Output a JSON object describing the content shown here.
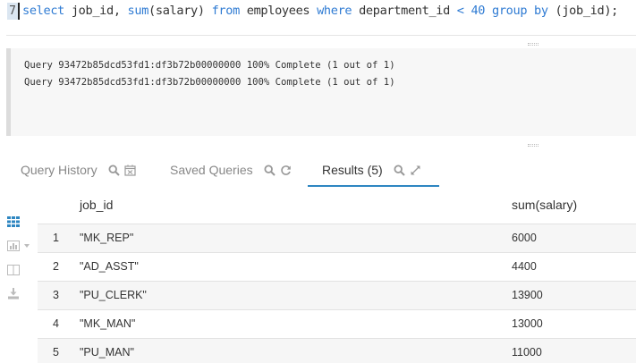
{
  "editor": {
    "line_number": "7",
    "tokens": [
      {
        "t": "select",
        "kw": true
      },
      {
        "t": " job_id, ",
        "kw": false
      },
      {
        "t": "sum",
        "kw": true
      },
      {
        "t": "(salary) ",
        "kw": false
      },
      {
        "t": "from",
        "kw": true
      },
      {
        "t": " employees ",
        "kw": false
      },
      {
        "t": "where",
        "kw": true
      },
      {
        "t": " department_id ",
        "kw": false
      },
      {
        "t": "<",
        "kw": true
      },
      {
        "t": " ",
        "kw": false
      },
      {
        "t": "40",
        "kw": true
      },
      {
        "t": " ",
        "kw": false
      },
      {
        "t": "group",
        "kw": true
      },
      {
        "t": " ",
        "kw": false
      },
      {
        "t": "by",
        "kw": true
      },
      {
        "t": " (job_id);",
        "kw": false
      }
    ]
  },
  "log": {
    "lines": [
      "Query 93472b85dcd53fd1:df3b72b00000000 100% Complete (1 out of 1)",
      "Query 93472b85dcd53fd1:df3b72b00000000 100% Complete (1 out of 1)"
    ]
  },
  "tabs": {
    "query_history": "Query History",
    "saved_queries": "Saved Queries",
    "results": "Results (5)"
  },
  "table": {
    "headers": [
      "job_id",
      "sum(salary)"
    ],
    "rows": [
      {
        "idx": "1",
        "job_id": "\"MK_REP\"",
        "salary": "6000"
      },
      {
        "idx": "2",
        "job_id": "\"AD_ASST\"",
        "salary": "4400"
      },
      {
        "idx": "3",
        "job_id": "\"PU_CLERK\"",
        "salary": "13900"
      },
      {
        "idx": "4",
        "job_id": "\"MK_MAN\"",
        "salary": "13000"
      },
      {
        "idx": "5",
        "job_id": "\"PU_MAN\"",
        "salary": "11000"
      }
    ]
  },
  "colors": {
    "accent": "#2e86c1",
    "keyword": "#2f7bd3"
  }
}
